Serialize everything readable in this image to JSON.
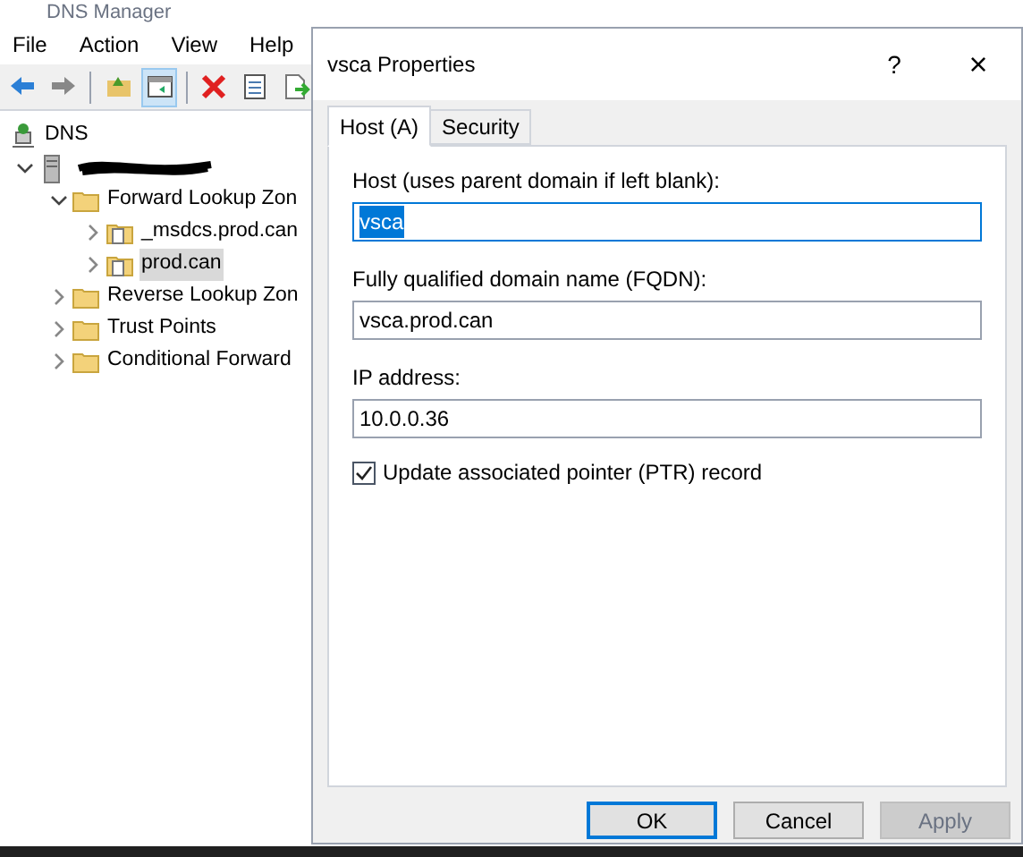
{
  "window": {
    "title": "DNS Manager"
  },
  "menu": [
    "File",
    "Action",
    "View",
    "Help"
  ],
  "toolbar": [
    {
      "kind": "back",
      "selected": false
    },
    {
      "kind": "forward",
      "selected": false
    },
    {
      "kind": "up",
      "selected": false
    },
    {
      "kind": "pane",
      "selected": true
    },
    {
      "kind": "delete",
      "selected": false
    },
    {
      "kind": "properties",
      "selected": false
    },
    {
      "kind": "export",
      "selected": false
    }
  ],
  "tree": [
    {
      "label": "DNS",
      "kind": "dns",
      "children": [
        {
          "kind": "server",
          "redacted": true,
          "expanded": true,
          "children": [
            {
              "label": "Forward Lookup Zon",
              "kind": "folder",
              "expanded": true,
              "selected": false,
              "children": [
                {
                  "label": "_msdcs.prod.can",
                  "kind": "zone",
                  "expanded": false,
                  "selected": false
                },
                {
                  "label": "prod.can",
                  "kind": "zone",
                  "expanded": false,
                  "selected": true
                }
              ]
            },
            {
              "label": "Reverse Lookup Zon",
              "kind": "folder",
              "expanded": false,
              "selected": false
            },
            {
              "label": "Trust Points",
              "kind": "folder",
              "expanded": false,
              "selected": false
            },
            {
              "label": "Conditional Forward",
              "kind": "folder",
              "expanded": false,
              "selected": false
            }
          ]
        }
      ]
    }
  ],
  "dialog": {
    "title": "vsca Properties",
    "help": "?",
    "close": "×",
    "tabs": [
      {
        "label": "Host (A)",
        "selected": true
      },
      {
        "label": "Security",
        "selected": false
      }
    ],
    "fields": [
      {
        "label": "Host (uses parent domain if left blank):",
        "value": "vsca",
        "focused": true
      },
      {
        "label": "Fully qualified domain name (FQDN):",
        "value": "vsca.prod.can",
        "focused": false
      },
      {
        "label": "IP address:",
        "value": "10.0.0.36",
        "focused": false
      }
    ],
    "checkbox": {
      "label": "Update associated pointer (PTR) record",
      "checked": true
    },
    "buttons": [
      {
        "label": "OK",
        "default": true,
        "disabled": false
      },
      {
        "label": "Cancel",
        "default": false,
        "disabled": false
      },
      {
        "label": "Apply",
        "default": false,
        "disabled": true
      }
    ]
  }
}
